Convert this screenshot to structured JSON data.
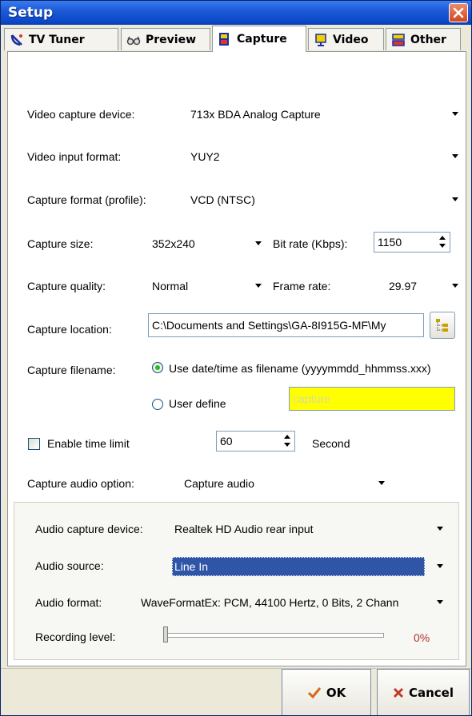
{
  "window": {
    "title": "Setup"
  },
  "tabs": [
    {
      "label": "TV Tuner",
      "icon": "satellite-dish-icon"
    },
    {
      "label": "Preview",
      "icon": "glasses-icon"
    },
    {
      "label": "Capture",
      "icon": "film-capture-icon",
      "active": true
    },
    {
      "label": "Video",
      "icon": "monitor-icon"
    },
    {
      "label": "Other",
      "icon": "other-settings-icon"
    }
  ],
  "capture": {
    "video_device": {
      "label": "Video capture device:",
      "value": "713x BDA Analog Capture"
    },
    "video_input_format": {
      "label": "Video input format:",
      "value": "YUY2"
    },
    "capture_format": {
      "label": "Capture format (profile):",
      "value": "VCD (NTSC)"
    },
    "capture_size": {
      "label": "Capture size:",
      "value": "352x240"
    },
    "bit_rate": {
      "label": "Bit rate (Kbps):",
      "value": "1150"
    },
    "capture_quality": {
      "label": "Capture quality:",
      "value": "Normal"
    },
    "frame_rate": {
      "label": "Frame rate:",
      "value": "29.97"
    },
    "location": {
      "label": "Capture location:",
      "value": "C:\\Documents and Settings\\GA-8I915G-MF\\My"
    },
    "filename": {
      "label": "Capture filename:",
      "option_datetime": "Use date/time as filename (yyyymmdd_hhmmss.xxx)",
      "option_user": "User define",
      "user_placeholder": "capture",
      "selected": "datetime"
    },
    "time_limit": {
      "label": "Enable time limit",
      "checked": false,
      "value": "60",
      "unit": "Second"
    },
    "audio_option": {
      "label": "Capture audio option:",
      "value": "Capture audio"
    }
  },
  "audio": {
    "device": {
      "label": "Audio capture device:",
      "value": "Realtek HD Audio rear input"
    },
    "source": {
      "label": "Audio source:",
      "value": "Line In"
    },
    "format": {
      "label": "Audio format:",
      "value": "WaveFormatEx: PCM, 44100 Hertz, 0 Bits, 2 Chann"
    },
    "recording_level": {
      "label": "Recording level:",
      "value_text": "0%",
      "level": 0
    }
  },
  "buttons": {
    "ok": "OK",
    "cancel": "Cancel"
  },
  "colors": {
    "title_bar": "#0a49c9",
    "close": "#d1451f",
    "highlight": "#2f55a6",
    "placeholder_bg": "#ffff00",
    "level_text": "#b03030"
  }
}
